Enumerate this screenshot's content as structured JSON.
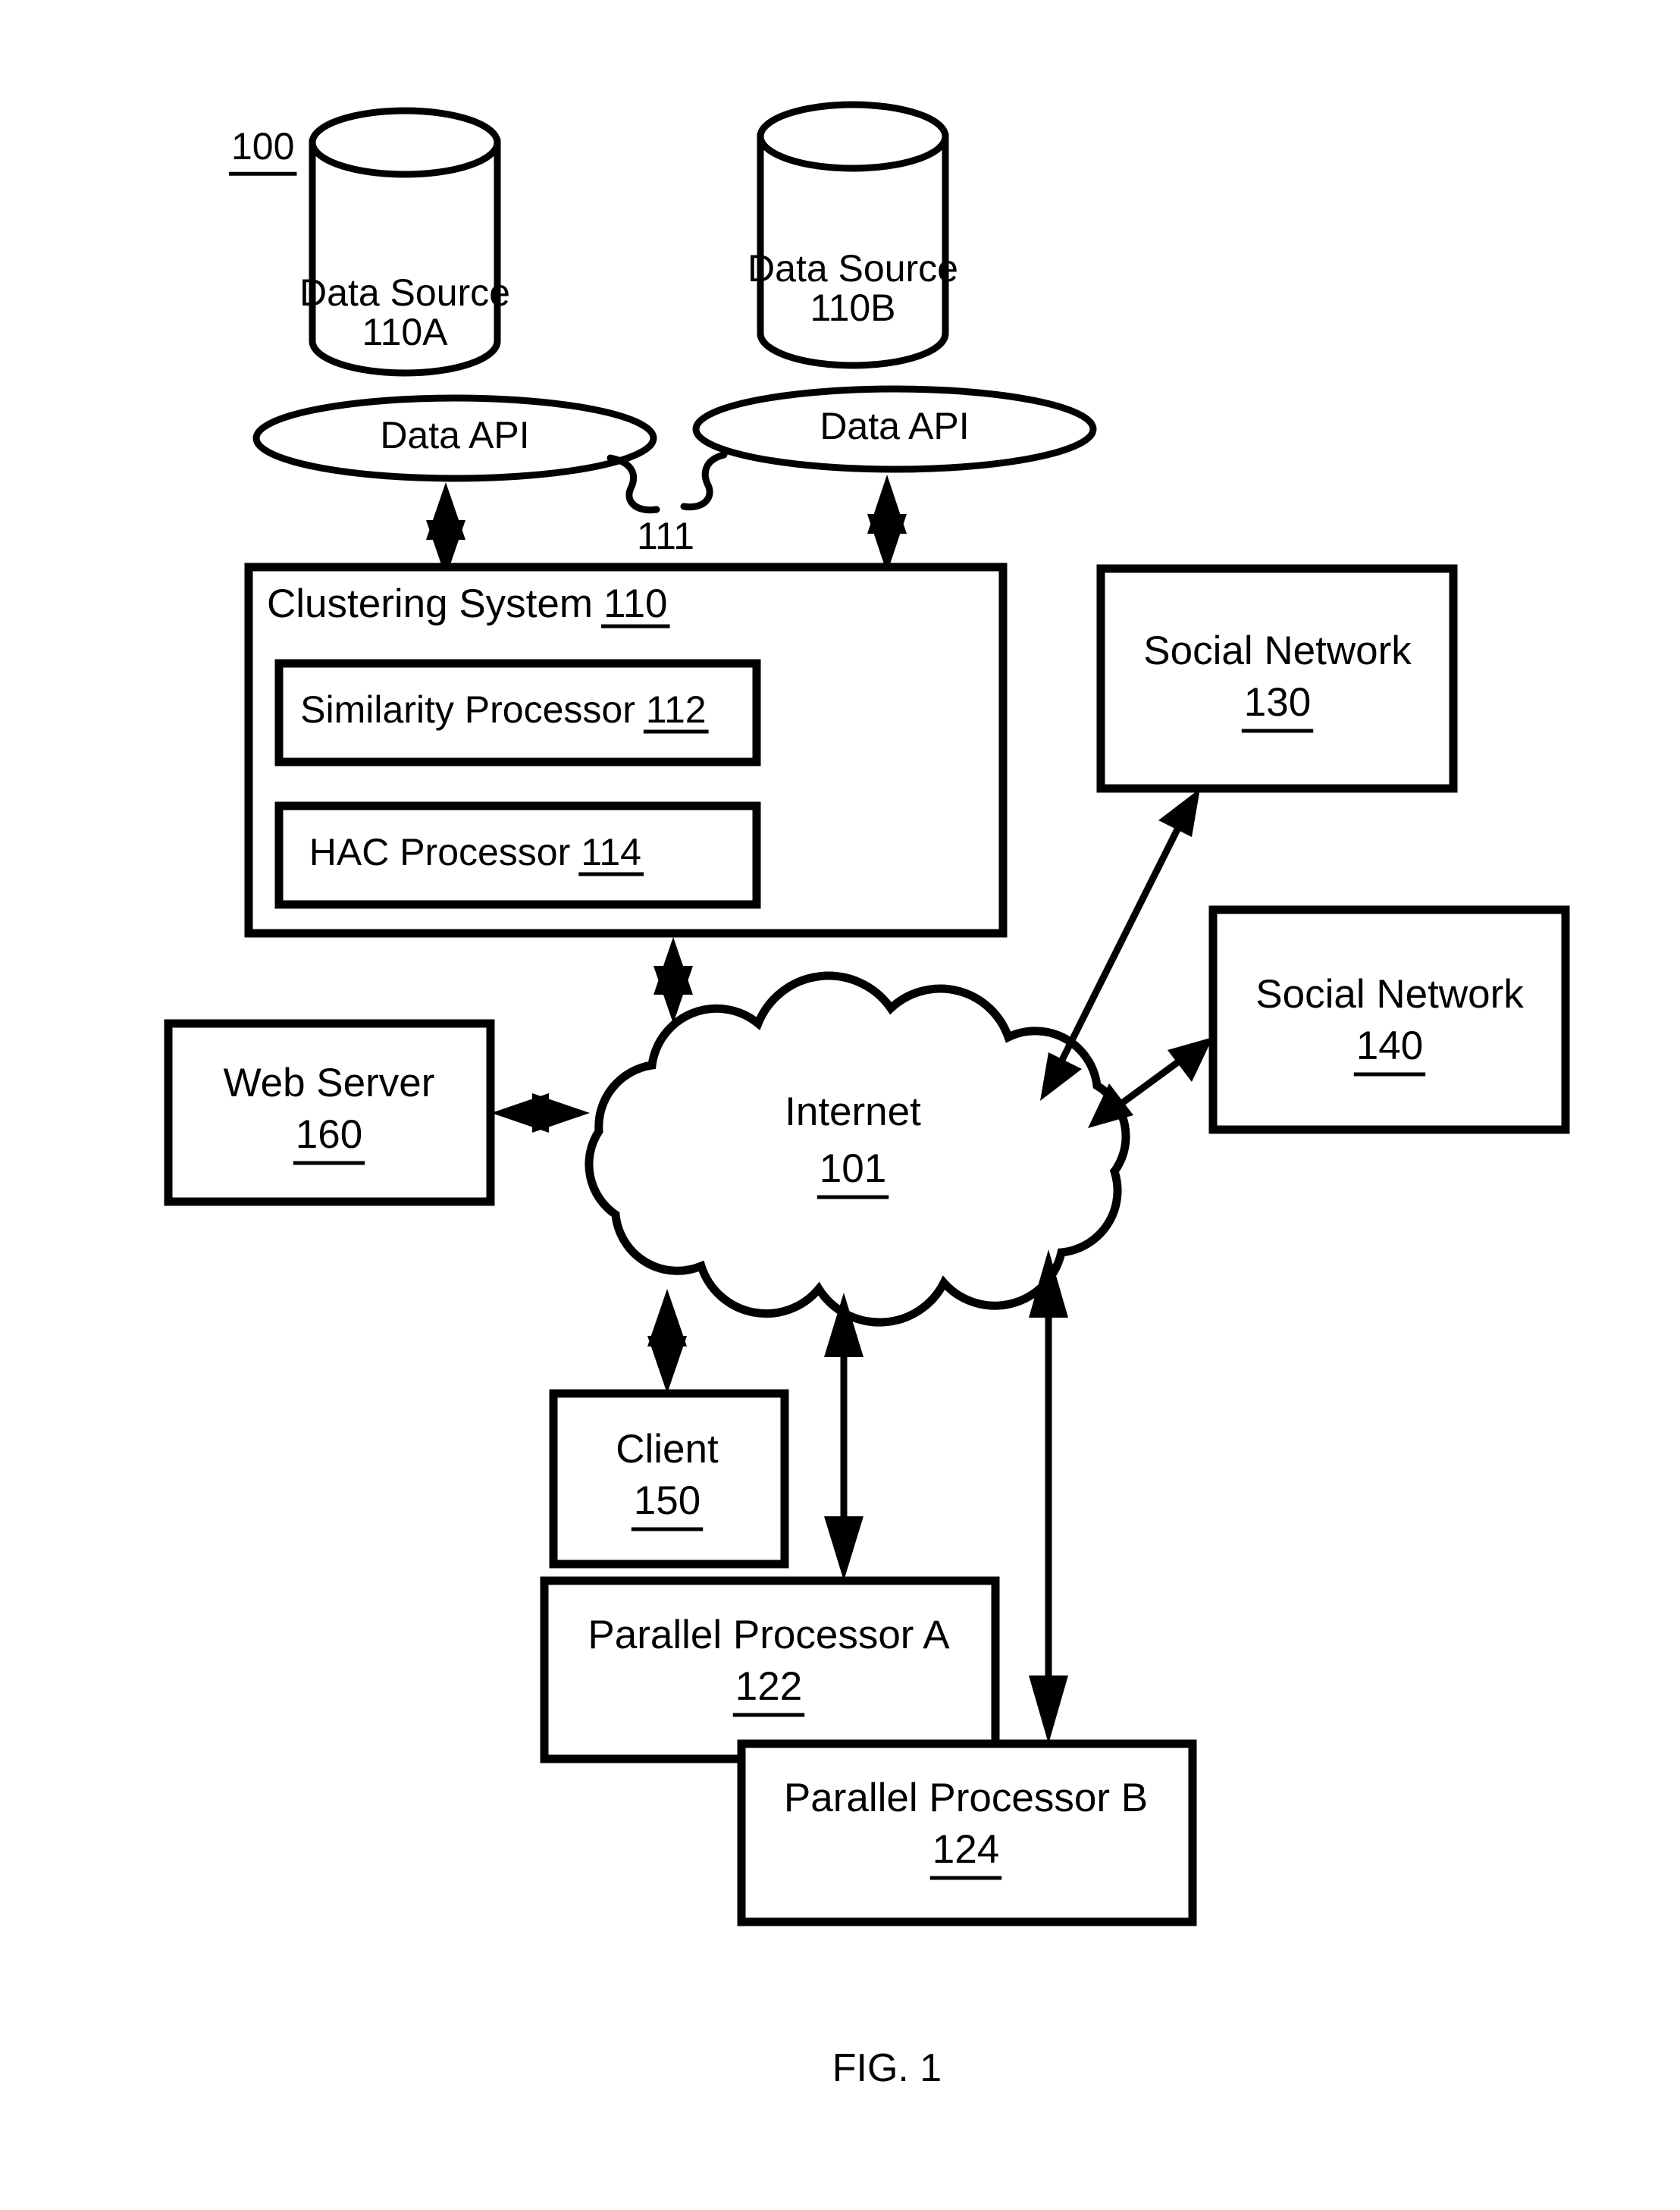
{
  "figure": {
    "number_label": "100",
    "caption": "FIG. 1",
    "connector_ref": "111"
  },
  "nodes": {
    "data_source_a": {
      "line1": "Data Source",
      "line2": "110A",
      "shape": "cylinder"
    },
    "data_source_b": {
      "line1": "Data Source",
      "line2": "110B",
      "shape": "cylinder"
    },
    "data_api_a": {
      "label": "Data API",
      "shape": "ellipse"
    },
    "data_api_b": {
      "label": "Data API",
      "shape": "ellipse"
    },
    "clustering_system": {
      "title": "Clustering System",
      "ref": "110",
      "shape": "rectangle"
    },
    "similarity_processor": {
      "title": "Similarity Processor",
      "ref": "112",
      "shape": "rectangle"
    },
    "hac_processor": {
      "title": "HAC Processor",
      "ref": "114",
      "shape": "rectangle"
    },
    "social_network_130": {
      "line1": "Social Network",
      "ref": "130",
      "shape": "rectangle"
    },
    "social_network_140": {
      "line1": "Social Network",
      "ref": "140",
      "shape": "rectangle"
    },
    "web_server": {
      "line1": "Web Server",
      "ref": "160",
      "shape": "rectangle"
    },
    "internet": {
      "line1": "Internet",
      "ref": "101",
      "shape": "cloud"
    },
    "client": {
      "line1": "Client",
      "ref": "150",
      "shape": "rectangle"
    },
    "parallel_processor_a": {
      "line1": "Parallel Processor A",
      "ref": "122",
      "shape": "rectangle"
    },
    "parallel_processor_b": {
      "line1": "Parallel Processor B",
      "ref": "124",
      "shape": "rectangle"
    }
  },
  "connections": [
    {
      "from": "clustering_system",
      "to": "data_api_a",
      "style": "double-arrow-vertical"
    },
    {
      "from": "clustering_system",
      "to": "data_api_b",
      "style": "double-arrow-vertical"
    },
    {
      "from": "clustering_system",
      "to": "internet",
      "style": "double-arrow-vertical"
    },
    {
      "from": "internet",
      "to": "social_network_130",
      "style": "double-arrow-diagonal"
    },
    {
      "from": "internet",
      "to": "social_network_140",
      "style": "double-arrow-diagonal"
    },
    {
      "from": "web_server",
      "to": "internet",
      "style": "double-arrow-horizontal"
    },
    {
      "from": "internet",
      "to": "client",
      "style": "double-arrow-vertical"
    },
    {
      "from": "internet",
      "to": "parallel_processor_a",
      "style": "double-arrow-vertical"
    },
    {
      "from": "internet",
      "to": "parallel_processor_b",
      "style": "double-arrow-vertical"
    }
  ],
  "colors": {
    "ink": "#000000",
    "paper": "#ffffff"
  }
}
